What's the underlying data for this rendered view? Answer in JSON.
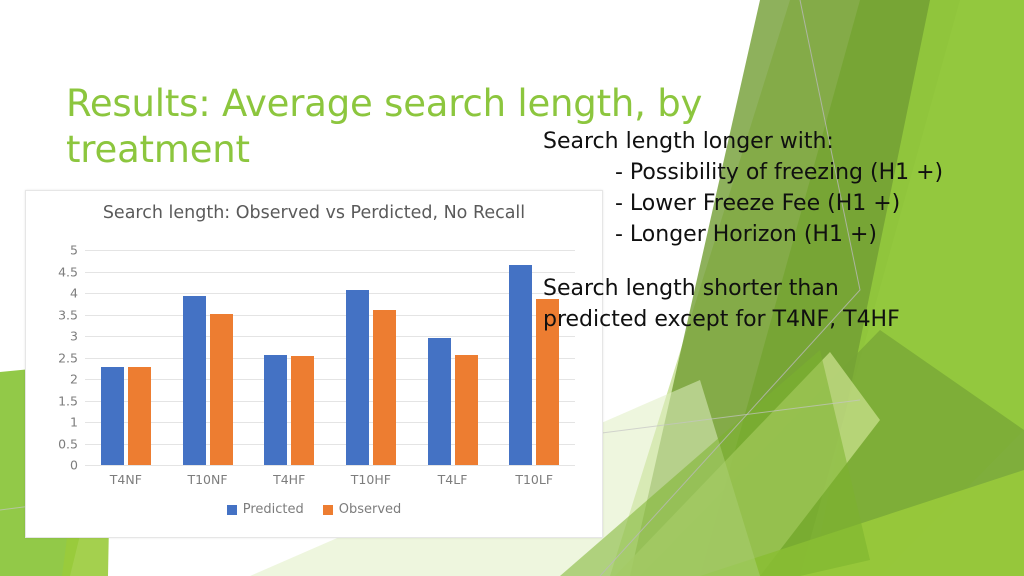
{
  "slide": {
    "title": "Results: Average search length, by treatment",
    "title_color": "#8CC63E",
    "background_color": "#FFFFFF"
  },
  "body": {
    "heading1": "Search length longer with:",
    "bullets": [
      "- Possibility of freezing (H1 +)",
      "- Lower Freeze Fee (H1 +)",
      "- Longer Horizon (H1 +)"
    ],
    "paragraph": "Search length shorter than predicted except for T4NF, T4HF"
  },
  "chart_data": {
    "type": "bar",
    "title": "Search length: Observed vs Perdicted, No Recall",
    "xlabel": "",
    "ylabel": "",
    "ylim": [
      0,
      5
    ],
    "grid": true,
    "legend_position": "bottom",
    "categories": [
      "T4NF",
      "T10NF",
      "T4HF",
      "T10HF",
      "T4LF",
      "T10LF"
    ],
    "yticks": [
      "0",
      "0.5",
      "1",
      "1.5",
      "2",
      "2.5",
      "3",
      "3.5",
      "4",
      "4.5",
      "5"
    ],
    "series": [
      {
        "name": "Predicted",
        "color": "#4472C4",
        "values": [
          2.27,
          3.93,
          2.57,
          4.07,
          2.95,
          4.65
        ]
      },
      {
        "name": "Observed",
        "color": "#ED7D31",
        "values": [
          2.27,
          3.52,
          2.53,
          3.6,
          2.57,
          3.87
        ]
      }
    ]
  },
  "decoration": {
    "greens": [
      "#8CC63E",
      "#76A336",
      "#A8CE5A",
      "#C9E08C",
      "#E0EEC2",
      "#7CB22E",
      "#9ACB3B"
    ]
  }
}
